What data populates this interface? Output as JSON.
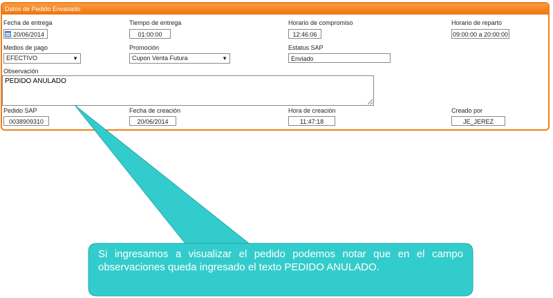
{
  "panel": {
    "title": "Datos de Pedido Envasado"
  },
  "fields": {
    "fecha_entrega": {
      "label": "Fecha de entrega",
      "value": "20/06/2014"
    },
    "tiempo_entrega": {
      "label": "Tiempo de entrega",
      "value": "01:00:00"
    },
    "horario_compromiso": {
      "label": "Horario de compromiso",
      "value": "12:46:06"
    },
    "horario_reparto": {
      "label": "Horario de reparto",
      "value": "09:00:00 a 20:00:00"
    },
    "medios_pago": {
      "label": "Medios de pago",
      "value": "EFECTIVO"
    },
    "promocion": {
      "label": "Promoción",
      "value": "Cupon Venta Futura"
    },
    "estatus_sap": {
      "label": "Estatus SAP",
      "value": "Enviado"
    },
    "observacion": {
      "label": "Observación",
      "value": "PEDIDO ANULADO"
    },
    "pedido_sap": {
      "label": "Pedido SAP",
      "value": "0038909310"
    },
    "fecha_creacion": {
      "label": "Fecha de creación",
      "value": "20/06/2014"
    },
    "hora_creacion": {
      "label": "Hora de creación",
      "value": "11:47:18"
    },
    "creado_por": {
      "label": "Creado por",
      "value": "JE_JEREZ"
    }
  },
  "callout": {
    "text": "Si ingresamos a visualizar el pedido podemos notar que en el campo observaciones queda ingresado el texto PEDIDO ANULADO."
  },
  "colors": {
    "panel_border": "#f07e1a",
    "header": "#f08020",
    "callout": "#33cccc"
  },
  "icons": {
    "calendar": "calendar-icon",
    "dropdown": "chevron-down-icon"
  }
}
